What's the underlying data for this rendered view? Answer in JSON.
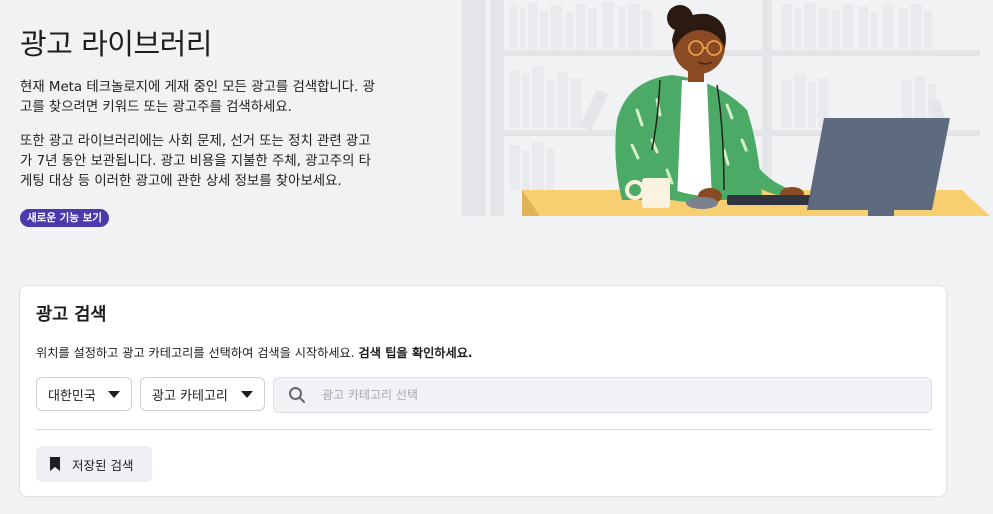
{
  "hero": {
    "title": "광고 라이브러리",
    "para1": "현재 Meta 테크놀로지에 게재 중인 모든 광고를 검색합니다. 광고를 찾으려면 키워드 또는 광고주를 검색하세요.",
    "para2": "또한 광고 라이브러리에는 사회 문제, 선거 또는 정치 관련 광고가 7년 동안 보관됩니다. 광고 비용을 지불한 주체, 광고주의 타게팅 대상 등 이러한 광고에 관한 상세 정보를 찾아보세요.",
    "badge": "새로운 기능 보기"
  },
  "search_card": {
    "title": "광고 검색",
    "description": "위치를 설정하고 광고 카테고리를 선택하여 검색을 시작하세요.",
    "tips_link": "검색 팁을 확인하세요.",
    "country_dropdown": "대한민국",
    "category_dropdown": "광고 카테고리",
    "search_placeholder": "광고 카테고리 선택",
    "saved_search_button": "저장된 검색"
  },
  "icons": {
    "search": "search-icon",
    "caret": "caret-down-icon",
    "bookmark": "bookmark-icon"
  },
  "colors": {
    "badge_bg": "#4a3aad",
    "page_bg": "#f1f2f4",
    "search_bg": "#f0f2f5"
  }
}
